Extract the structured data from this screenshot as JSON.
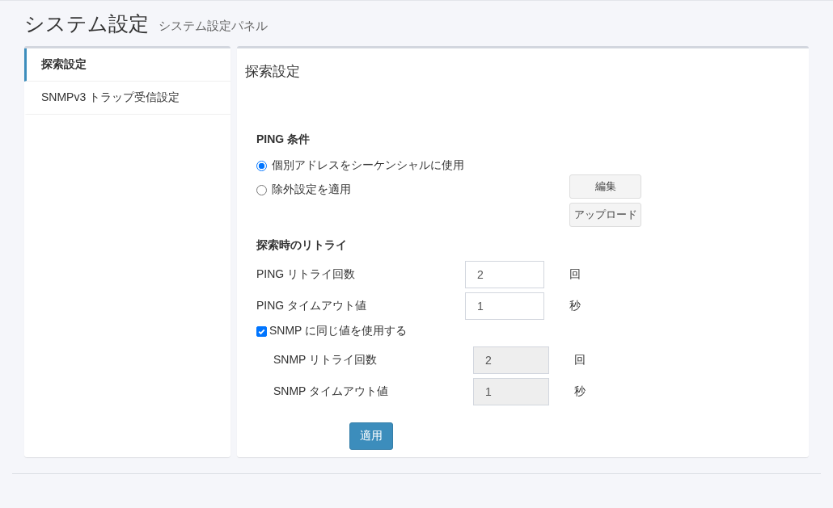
{
  "header": {
    "title": "システム設定",
    "subtitle": "システム設定パネル"
  },
  "sidebar": {
    "items": [
      {
        "label": "探索設定",
        "selected": true
      },
      {
        "label": "SNMPv3 トラップ受信設定",
        "selected": false
      }
    ]
  },
  "panel": {
    "title": "探索設定",
    "ping": {
      "heading": "PING 条件",
      "options": [
        {
          "label": "個別アドレスをシーケンシャルに使用",
          "selected": true
        },
        {
          "label": "除外設定を適用",
          "selected": false
        }
      ],
      "buttons": [
        "編集",
        "アップロード"
      ]
    },
    "retry": {
      "heading": "探索時のリトライ",
      "fields": [
        {
          "label": "PING リトライ回数",
          "value": "2",
          "unit": "回",
          "disabled": false
        },
        {
          "label": "PING タイムアウト値",
          "value": "1",
          "unit": "秒",
          "disabled": false
        }
      ],
      "same_value": {
        "label": "SNMP に同じ値を使用する",
        "checked": true
      },
      "snmp_fields": [
        {
          "label": "SNMP リトライ回数",
          "value": "2",
          "unit": "回",
          "disabled": true
        },
        {
          "label": "SNMP タイムアウト値",
          "value": "1",
          "unit": "秒",
          "disabled": true
        }
      ]
    },
    "apply_button": "適用"
  }
}
